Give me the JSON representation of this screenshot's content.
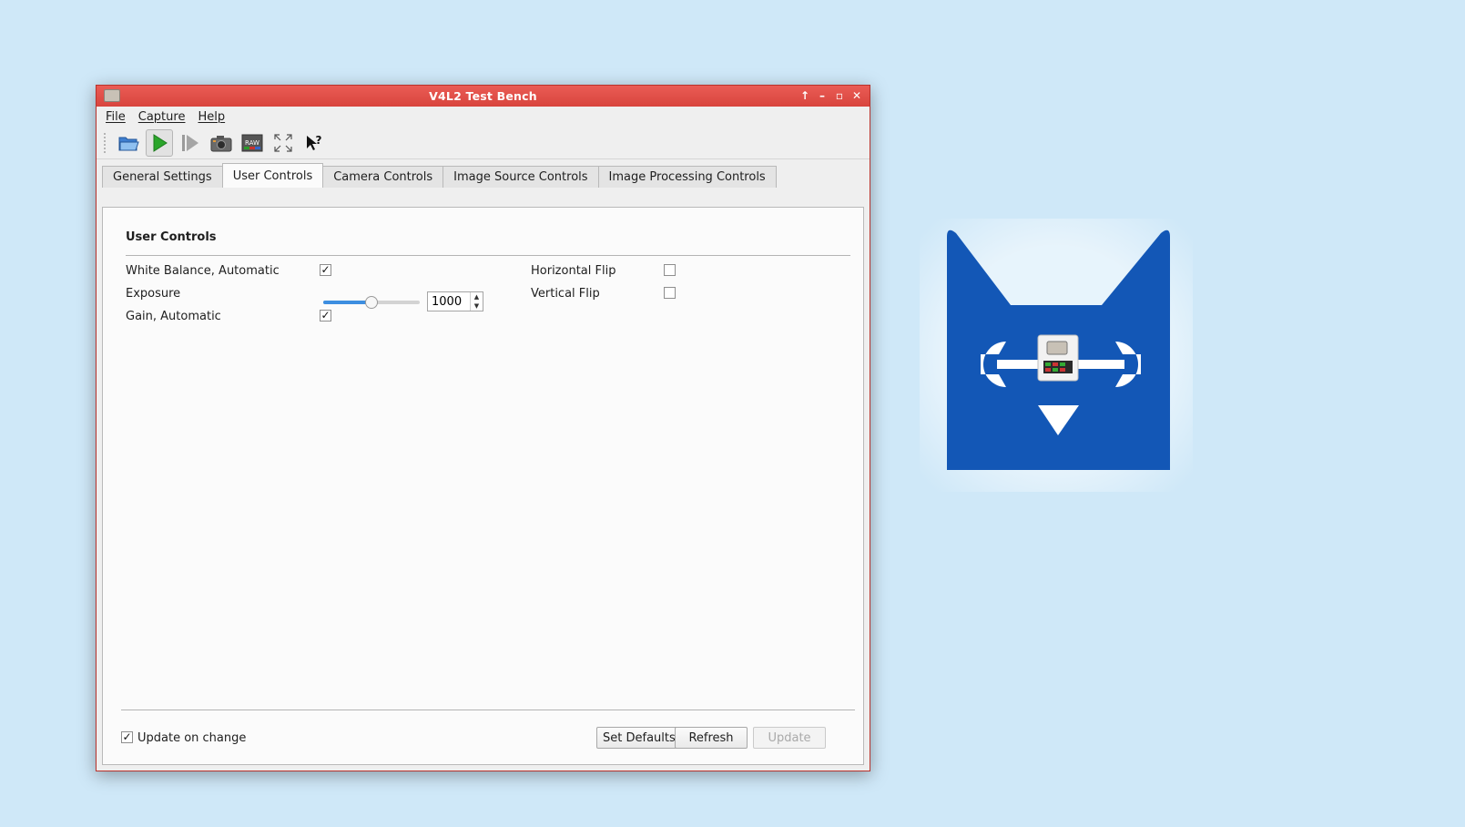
{
  "window": {
    "title": "V4L2 Test Bench",
    "controls": [
      "keep-above-icon",
      "minimize-icon",
      "maximize-icon",
      "close-icon"
    ]
  },
  "menu": {
    "items": [
      "File",
      "Capture",
      "Help"
    ]
  },
  "toolbar": {
    "buttons": [
      "open-device-icon",
      "start-capture-icon",
      "single-step-icon",
      "snapshot-icon",
      "raw-capture-icon",
      "fullscreen-icon",
      "whats-this-icon"
    ],
    "active": "start-capture-icon"
  },
  "tabs": {
    "items": [
      "General Settings",
      "User Controls",
      "Camera Controls",
      "Image Source Controls",
      "Image Processing Controls"
    ],
    "active_index": 1
  },
  "panel": {
    "section_title": "User Controls",
    "white_balance": {
      "label": "White Balance, Automatic",
      "checked": true
    },
    "exposure": {
      "label": "Exposure",
      "value": "1000",
      "slider_fraction": 0.5
    },
    "gain": {
      "label": "Gain, Automatic",
      "checked": true
    },
    "hflip": {
      "label": "Horizontal Flip",
      "checked": false
    },
    "vflip": {
      "label": "Vertical Flip",
      "checked": false
    }
  },
  "footer": {
    "update_on_change": {
      "label": "Update on change",
      "checked": true
    },
    "set_defaults": "Set Defaults",
    "refresh": "Refresh",
    "update": "Update"
  },
  "colors": {
    "titlebar": "#dd4a43",
    "accent": "#3d8ee0",
    "desktop": "#cfe8f8",
    "logo_blue": "#1357b6"
  }
}
